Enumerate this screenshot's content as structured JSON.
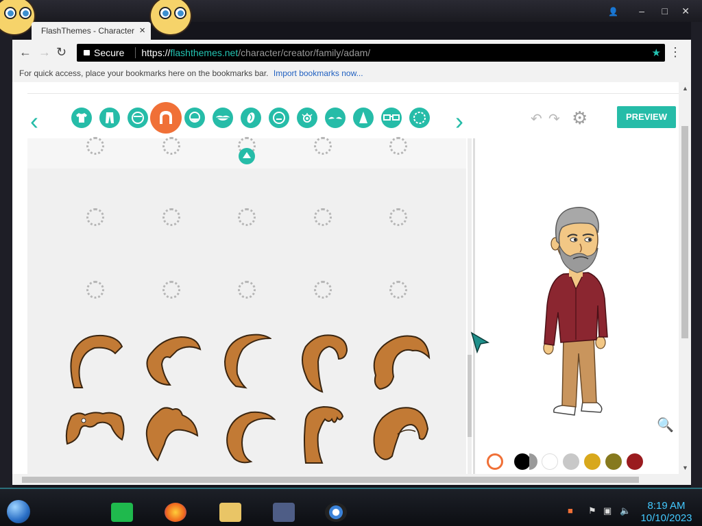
{
  "browser": {
    "tab_title": "FlashThemes - Character",
    "tab_close": "×",
    "secure_label": "Secure",
    "url_scheme": "https://",
    "url_host": "flashthemes.net",
    "url_path": "/character/creator/family/adam/",
    "bookmarks_hint": "For quick access, place your bookmarks here on the bookmarks bar.",
    "import_link": "Import bookmarks now..."
  },
  "editor": {
    "preview_label": "PREVIEW",
    "tools": [
      {
        "name": "shirt-icon",
        "selected": false
      },
      {
        "name": "pants-icon",
        "selected": false
      },
      {
        "name": "head-icon",
        "selected": false
      },
      {
        "name": "hair-icon",
        "selected": true
      },
      {
        "name": "facial-hair-icon",
        "selected": false
      },
      {
        "name": "mouth-icon",
        "selected": false
      },
      {
        "name": "ear-icon",
        "selected": false
      },
      {
        "name": "face-shape-icon",
        "selected": false
      },
      {
        "name": "eye-icon",
        "selected": false
      },
      {
        "name": "eyebrow-icon",
        "selected": false
      },
      {
        "name": "nose-icon",
        "selected": false
      },
      {
        "name": "glasses-icon",
        "selected": false
      },
      {
        "name": "beard-shape-icon",
        "selected": false
      }
    ],
    "hair_color_swatches": [
      "#000000",
      "#ffffff",
      "#c8c8c8",
      "#d8a81c",
      "#86791e",
      "#9a1b1f"
    ],
    "hair_fill": "#c27a35"
  },
  "taskbar": {
    "time": "8:19 AM",
    "date": "10/10/2023"
  },
  "colors": {
    "accent": "#26bca8",
    "selected": "#f07037"
  }
}
